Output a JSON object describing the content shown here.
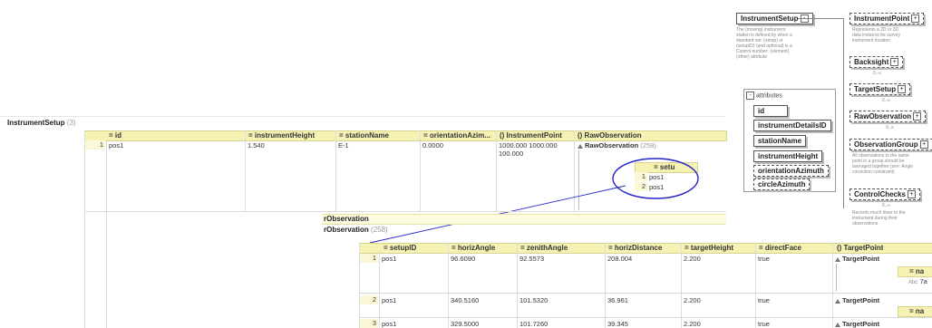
{
  "schema": {
    "root_label": "InstrumentSetup",
    "root_desc": "The (moving) instrument station is defined by when a standard set: (setup) or (setupID) (and optional) is a Control number: (element) (other) attribute",
    "children": [
      {
        "label": "InstrumentPoint",
        "desc": "Represents a 2D or 3D data instance for survey instrument location",
        "occ": ""
      },
      {
        "label": "Backsight",
        "desc": "",
        "occ": "0..∞"
      },
      {
        "label": "TargetSetup",
        "desc": "",
        "occ": "0..∞"
      },
      {
        "label": "RawObservation",
        "desc": "",
        "occ": "0..∞"
      },
      {
        "label": "ObservationGroup",
        "desc": "All observations to the same point in a group should be averaged together (see: Angle correction constraint)",
        "occ": "0..∞"
      },
      {
        "label": "ControlChecks",
        "desc": "Records much timer to the instrument during their observations",
        "occ": "0..∞"
      }
    ],
    "attributes_label": "attributes",
    "attributes": [
      "id",
      "instrumentDetailsID",
      "stationName",
      "instrumentHeight",
      "orientationAzimuth",
      "circleAzimuth"
    ]
  },
  "top_grid": {
    "title": "InstrumentSetup",
    "count": "(3)",
    "headers": [
      "= id",
      "= instrumentHeight",
      "= stationName",
      "= orientationAzim...",
      "() InstrumentPoint",
      "() RawObservation"
    ],
    "row": {
      "num": "1",
      "id": "pos1",
      "instrumentHeight": "1.540",
      "stationName": "E-1",
      "orientationAzimuth": "0.0000",
      "instrumentPoint": "1000.000 1000.000 100.000",
      "rawObservation": "RawObservation",
      "rawCount": "(258)"
    },
    "nested": {
      "header": "= setu",
      "rows": [
        {
          "num": "1",
          "val": "pos1"
        },
        {
          "num": "2",
          "val": "pos1"
        }
      ]
    }
  },
  "mid": {
    "title": "rObservation",
    "subtitle": "rObservation",
    "count": "(258)"
  },
  "bottom_grid": {
    "headers": [
      "= setupID",
      "= horizAngle",
      "= zenithAngle",
      "= horizDistance",
      "= targetHeight",
      "= directFace",
      "() TargetPoint"
    ],
    "rows": [
      {
        "num": "1",
        "setupID": "pos1",
        "horizAngle": "96.6090",
        "zenithAngle": "92.5573",
        "horizDistance": "208.004",
        "targetHeight": "2.200",
        "directFace": "true",
        "targetPoint": "TargetPoint"
      },
      {
        "num": "2",
        "setupID": "pos1",
        "horizAngle": "340.5160",
        "zenithAngle": "101.5320",
        "horizDistance": "36.961",
        "targetHeight": "2.200",
        "directFace": "true",
        "targetPoint": "TargetPoint"
      },
      {
        "num": "3",
        "setupID": "pos1",
        "horizAngle": "329.5000",
        "zenithAngle": "101.7260",
        "horizDistance": "39.345",
        "targetHeight": "2.200",
        "directFace": "true",
        "targetPoint": "TargetPoint"
      }
    ],
    "nested_label": "= na",
    "nested_value": "7a"
  },
  "colors": {
    "header": "#f6f2b4",
    "highlight_ellipse": "#2020c0"
  }
}
